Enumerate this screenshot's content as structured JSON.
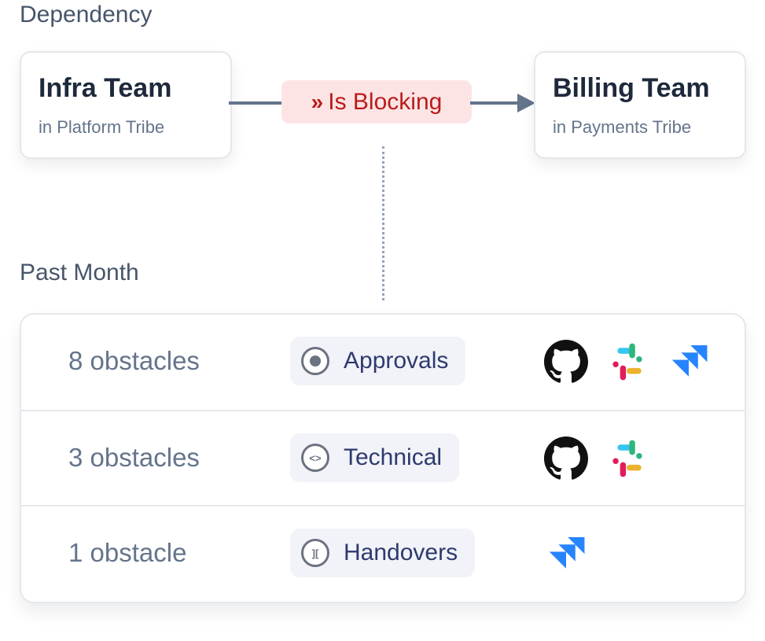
{
  "sections": {
    "dependency": "Dependency",
    "past_month": "Past Month"
  },
  "source_team": {
    "name": "Infra Team",
    "tribe": "in Platform Tribe"
  },
  "target_team": {
    "name": "Billing Team",
    "tribe": "in Payments Tribe"
  },
  "relation": {
    "icon": "chevrons-right-icon",
    "glyph": "»",
    "label": "Is Blocking",
    "color": "#b91c1c",
    "background": "#fde4e4"
  },
  "obstacles": [
    {
      "count": "8 obstacles",
      "category": "Approvals",
      "category_icon": "radio-dot-icon",
      "tools": [
        "github",
        "slack",
        "jira"
      ]
    },
    {
      "count": "3 obstacles",
      "category": "Technical",
      "category_icon": "code-icon",
      "category_glyph": "<>",
      "tools": [
        "github",
        "slack"
      ]
    },
    {
      "count": "1 obstacle",
      "category": "Handovers",
      "category_icon": "handover-icon",
      "category_glyph": "][",
      "tools": [
        "jira"
      ]
    }
  ]
}
